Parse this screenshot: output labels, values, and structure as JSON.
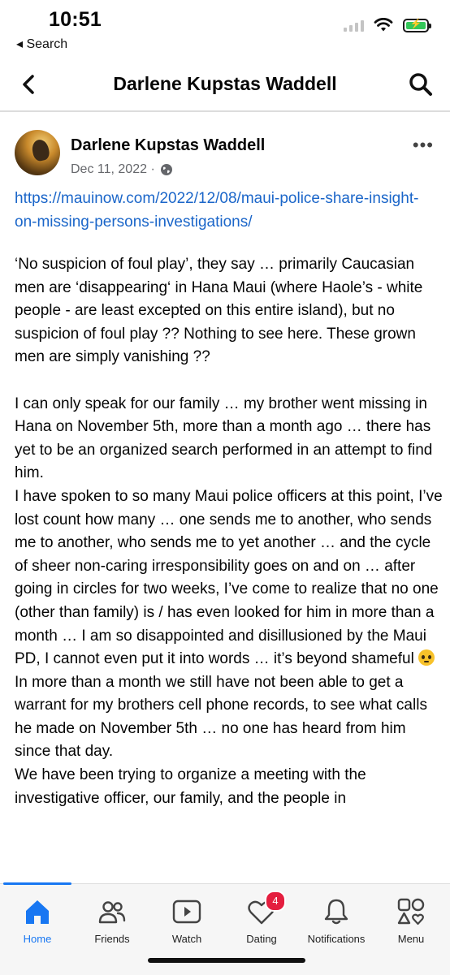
{
  "status_bar": {
    "time": "10:51",
    "back_label": "◂ Search"
  },
  "header": {
    "title": "Darlene Kupstas Waddell"
  },
  "post": {
    "author": "Darlene Kupstas Waddell",
    "date": "Dec 11, 2022 ·",
    "link": "https://mauinow.com/2022/12/08/maui-police-share-insight-on-missing-persons-investigations/",
    "body": "‘No suspicion of foul play’, they say … primarily Caucasian men are ‘disappearing‘ in Hana Maui (where Haole’s - white people - are least excepted on this entire island), but no suspicion of foul play ?? Nothing to see here. These grown men are simply vanishing ??\n\nI can only speak for our family … my brother went missing in Hana on November 5th, more than a month ago … there has yet to be an organized search performed in an attempt to find him.\nI have spoken to so many Maui police officers at this point, I’ve lost count how many … one sends me to another, who sends me to another, who sends me to yet another … and the cycle of sheer non-caring irresponsibility goes on and on … after going in circles for two weeks, I’ve come to realize that no one (other than family) is / has even looked for him in more than a month … I am so disappointed and disillusioned by the Maui PD, I cannot even put it into words … it’s beyond shameful",
    "body_end": "In more than a month we still have not been able to get a warrant for my brothers cell phone records, to see what calls he made on November 5th … no one has heard from him since that day.\nWe have been trying to organize a meeting with the investigative officer, our family, and the people in"
  },
  "nav": {
    "items": [
      {
        "label": "Home",
        "icon": "home-icon"
      },
      {
        "label": "Friends",
        "icon": "friends-icon"
      },
      {
        "label": "Watch",
        "icon": "watch-icon"
      },
      {
        "label": "Dating",
        "icon": "dating-icon",
        "badge": "4"
      },
      {
        "label": "Notifications",
        "icon": "bell-icon"
      },
      {
        "label": "Menu",
        "icon": "menu-icon"
      }
    ]
  },
  "colors": {
    "accent": "#1877f2",
    "link": "#1b66c9",
    "badge": "#e41e3f",
    "battery": "#34c759"
  }
}
